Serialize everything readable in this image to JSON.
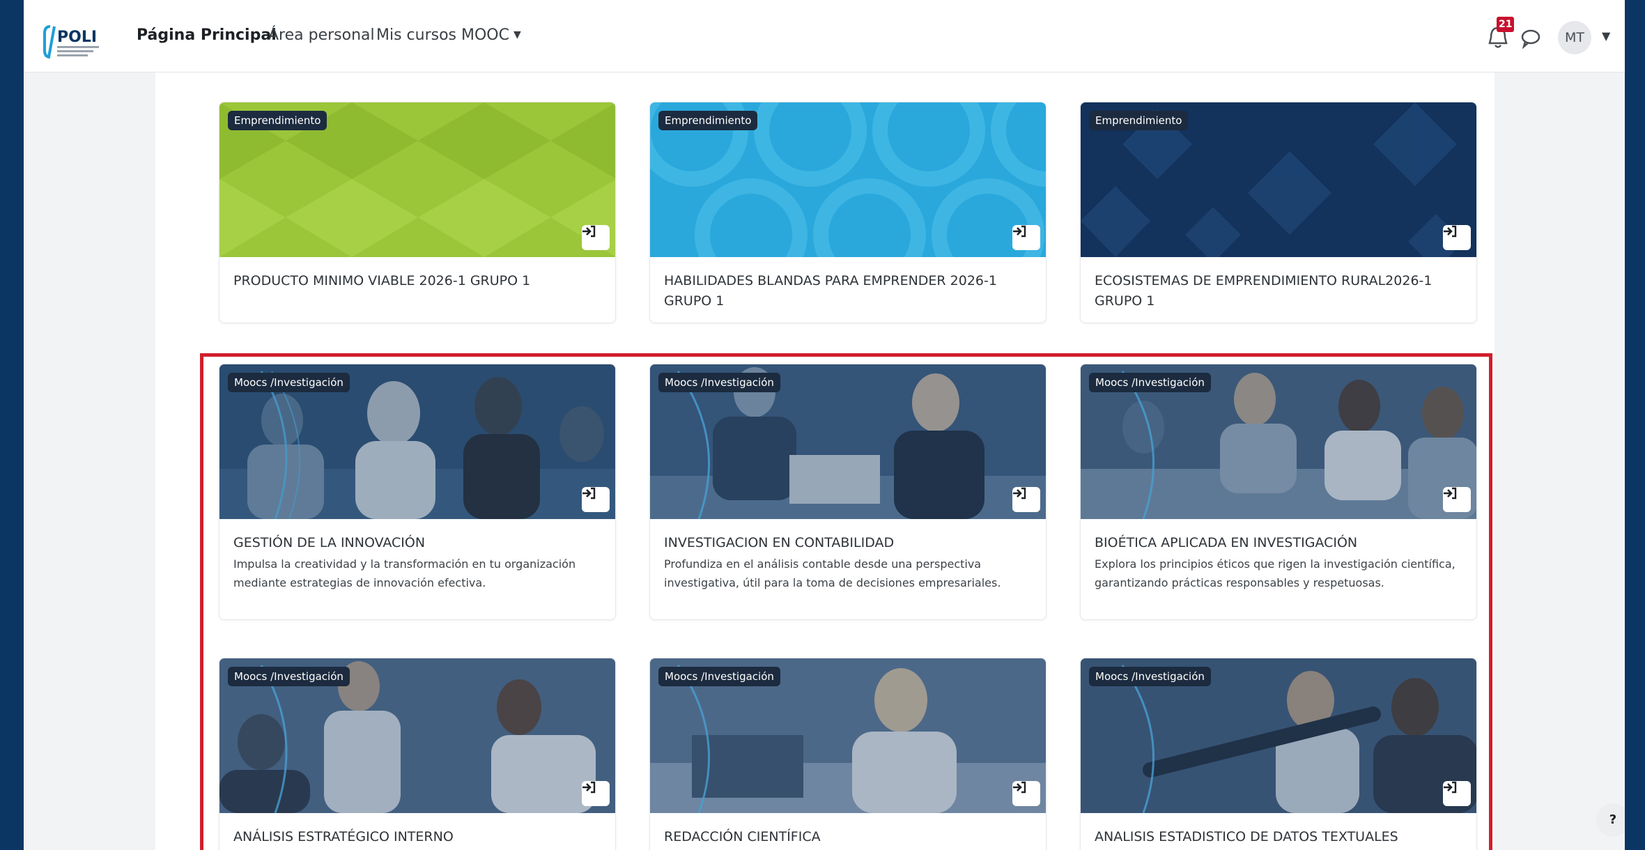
{
  "navbar": {
    "logo_text": "POLI",
    "links": [
      {
        "label": "Página Principal"
      },
      {
        "label": "Área personal"
      },
      {
        "label": "Mis cursos"
      },
      {
        "label": "MOOC"
      }
    ],
    "notification_count": "21",
    "user_initials": "MT"
  },
  "courses_emprendimiento": [
    {
      "category": "Emprendimiento",
      "title": "PRODUCTO MINIMO VIABLE 2026-1 GRUPO 1",
      "image_color": "#9bc63a"
    },
    {
      "category": "Emprendimiento",
      "title": "HABILIDADES BLANDAS PARA EMPRENDER 2026-1 GRUPO 1",
      "image_color": "#2aa8dc"
    },
    {
      "category": "Emprendimiento",
      "title": "ECOSISTEMAS DE EMPRENDIMIENTO RURAL2026-1 GRUPO 1",
      "image_color": "#13325c"
    }
  ],
  "courses_mooc": [
    {
      "category": "Moocs /Investigación",
      "title": "GESTIÓN DE LA INNOVACIÓN",
      "description": "Impulsa la creatividad y la transformación en tu organización mediante estrategias de innovación efectiva."
    },
    {
      "category": "Moocs /Investigación",
      "title": "INVESTIGACION EN CONTABILIDAD",
      "description": "Profundiza en el análisis contable desde una perspectiva investigativa, útil para la toma de decisiones empresariales."
    },
    {
      "category": "Moocs /Investigación",
      "title": "BIOÉTICA APLICADA EN INVESTIGACIÓN",
      "description": "Explora los principios éticos que rigen la investigación científica, garantizando prácticas responsables y respetuosas."
    },
    {
      "category": "Moocs /Investigación",
      "title": "ANÁLISIS ESTRATÉGICO INTERNO",
      "description": ""
    },
    {
      "category": "Moocs /Investigación",
      "title": "REDACCIÓN CIENTÍFICA",
      "description": ""
    },
    {
      "category": "Moocs /Investigación",
      "title": "ANALISIS ESTADISTICO DE DATOS TEXTUALES",
      "description": ""
    }
  ],
  "help_label": "?",
  "colors": {
    "highlight": "#d01f2d",
    "badge_bg": "#1c2b3f",
    "photo_tint": "#25476e"
  }
}
